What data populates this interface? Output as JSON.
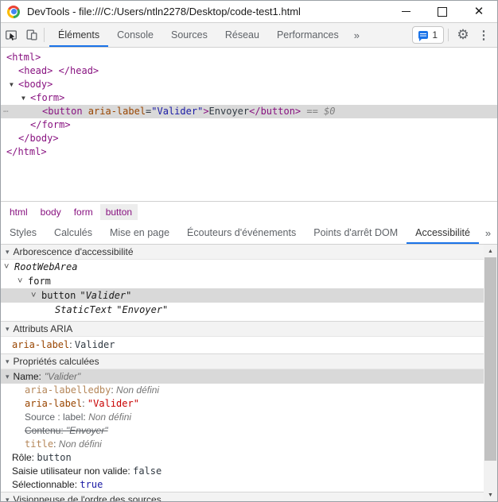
{
  "window": {
    "title": "DevTools - file:///C:/Users/ntln2278/Desktop/code-test1.html"
  },
  "icons": {
    "more_tabs": "»",
    "gear": "⚙",
    "kebab": "⋮",
    "section_triangle": "▾",
    "tree_arrow": "▼",
    "chevron_expanded": "˅",
    "scroll_up": "▲",
    "scroll_down": "▼",
    "gutter_dots": "…"
  },
  "toolbar": {
    "tabs": [
      {
        "label": "Éléments",
        "active": true
      },
      {
        "label": "Console",
        "active": false
      },
      {
        "label": "Sources",
        "active": false
      },
      {
        "label": "Réseau",
        "active": false
      },
      {
        "label": "Performances",
        "active": false
      }
    ],
    "message_badge_count": "1"
  },
  "elements_tree": {
    "rows": [
      {
        "indent": 0,
        "arrow": false,
        "selected": false,
        "segments": [
          {
            "t": "<html>",
            "c": "tag"
          }
        ]
      },
      {
        "indent": 1,
        "arrow": false,
        "selected": false,
        "segments": [
          {
            "t": "<head> </head>",
            "c": "tag"
          }
        ]
      },
      {
        "indent": 1,
        "arrow": true,
        "selected": false,
        "segments": [
          {
            "t": "<body>",
            "c": "tag"
          }
        ]
      },
      {
        "indent": 2,
        "arrow": true,
        "selected": false,
        "segments": [
          {
            "t": "<form>",
            "c": "tag"
          }
        ]
      },
      {
        "indent": 3,
        "arrow": false,
        "selected": true,
        "gutter": true,
        "segments": [
          {
            "t": "<button ",
            "c": "tag"
          },
          {
            "t": "aria-label",
            "c": "attr"
          },
          {
            "t": "=",
            "c": "text"
          },
          {
            "t": "\"Valider\"",
            "c": "value"
          },
          {
            "t": ">",
            "c": "tag"
          },
          {
            "t": "Envoyer",
            "c": "text"
          },
          {
            "t": "</button>",
            "c": "tag"
          },
          {
            "t": " == ",
            "c": "meta"
          },
          {
            "t": "$0",
            "c": "meta-italic"
          }
        ]
      },
      {
        "indent": 2,
        "arrow": false,
        "selected": false,
        "segments": [
          {
            "t": "</form>",
            "c": "tag"
          }
        ]
      },
      {
        "indent": 1,
        "arrow": false,
        "selected": false,
        "segments": [
          {
            "t": "</body>",
            "c": "tag"
          }
        ]
      },
      {
        "indent": 0,
        "arrow": false,
        "selected": false,
        "segments": [
          {
            "t": "</html>",
            "c": "tag"
          }
        ]
      }
    ]
  },
  "breadcrumb": {
    "items": [
      {
        "label": "html",
        "selected": false
      },
      {
        "label": "body",
        "selected": false
      },
      {
        "label": "form",
        "selected": false
      },
      {
        "label": "button",
        "selected": true
      }
    ]
  },
  "subtabs": {
    "tabs": [
      {
        "label": "Styles",
        "active": false
      },
      {
        "label": "Calculés",
        "active": false
      },
      {
        "label": "Mise en page",
        "active": false
      },
      {
        "label": "Écouteurs d'événements",
        "active": false
      },
      {
        "label": "Points d'arrêt DOM",
        "active": false
      },
      {
        "label": "Accessibilité",
        "active": true
      }
    ]
  },
  "accessibility": {
    "tree_section_title": "Arborescence d'accessibilité",
    "tree": [
      {
        "level": 0,
        "chevron": true,
        "name": "RootWebArea",
        "name_italic": true,
        "value": "",
        "selected": false
      },
      {
        "level": 1,
        "chevron": true,
        "name": "form",
        "name_italic": false,
        "value": "",
        "selected": false
      },
      {
        "level": 2,
        "chevron": true,
        "name": "button",
        "name_italic": false,
        "value": "\"Valider\"",
        "selected": true
      },
      {
        "level": 3,
        "chevron": false,
        "name": "StaticText",
        "name_italic": true,
        "value": "\"Envoyer\"",
        "selected": false
      }
    ],
    "aria_section_title": "Attributs ARIA",
    "aria_attributes": [
      {
        "name": "aria-label",
        "value": "Valider"
      }
    ],
    "computed_section_title": "Propriétés calculées",
    "name_property": {
      "label": "Name:",
      "value": "\"Valider\"",
      "sources": [
        {
          "name": "aria-labelledby",
          "mono": true,
          "defined": false,
          "value": "Non défini",
          "value_style": "undef",
          "struck": false
        },
        {
          "name": "aria-label",
          "mono": true,
          "defined": true,
          "value": "\"Valider\"",
          "value_style": "red",
          "struck": false
        },
        {
          "name": "Source : label",
          "mono": false,
          "defined": false,
          "value": "Non défini",
          "value_style": "undef",
          "struck": false
        },
        {
          "name": "Contenu",
          "mono": false,
          "defined": false,
          "value": "\"Envoyer\"",
          "value_style": "italic",
          "struck": true
        },
        {
          "name": "title",
          "mono": true,
          "defined": false,
          "value": "Non défini",
          "value_style": "undef",
          "struck": false
        }
      ]
    },
    "properties": [
      {
        "label": "Rôle",
        "value": "button",
        "value_color": "dark"
      },
      {
        "label": "Saisie utilisateur non valide",
        "value": "false",
        "value_color": "dark"
      },
      {
        "label": "Sélectionnable",
        "value": "true",
        "value_color": "blue"
      }
    ],
    "source_order_section_title": "Visionneuse de l'ordre des sources"
  }
}
